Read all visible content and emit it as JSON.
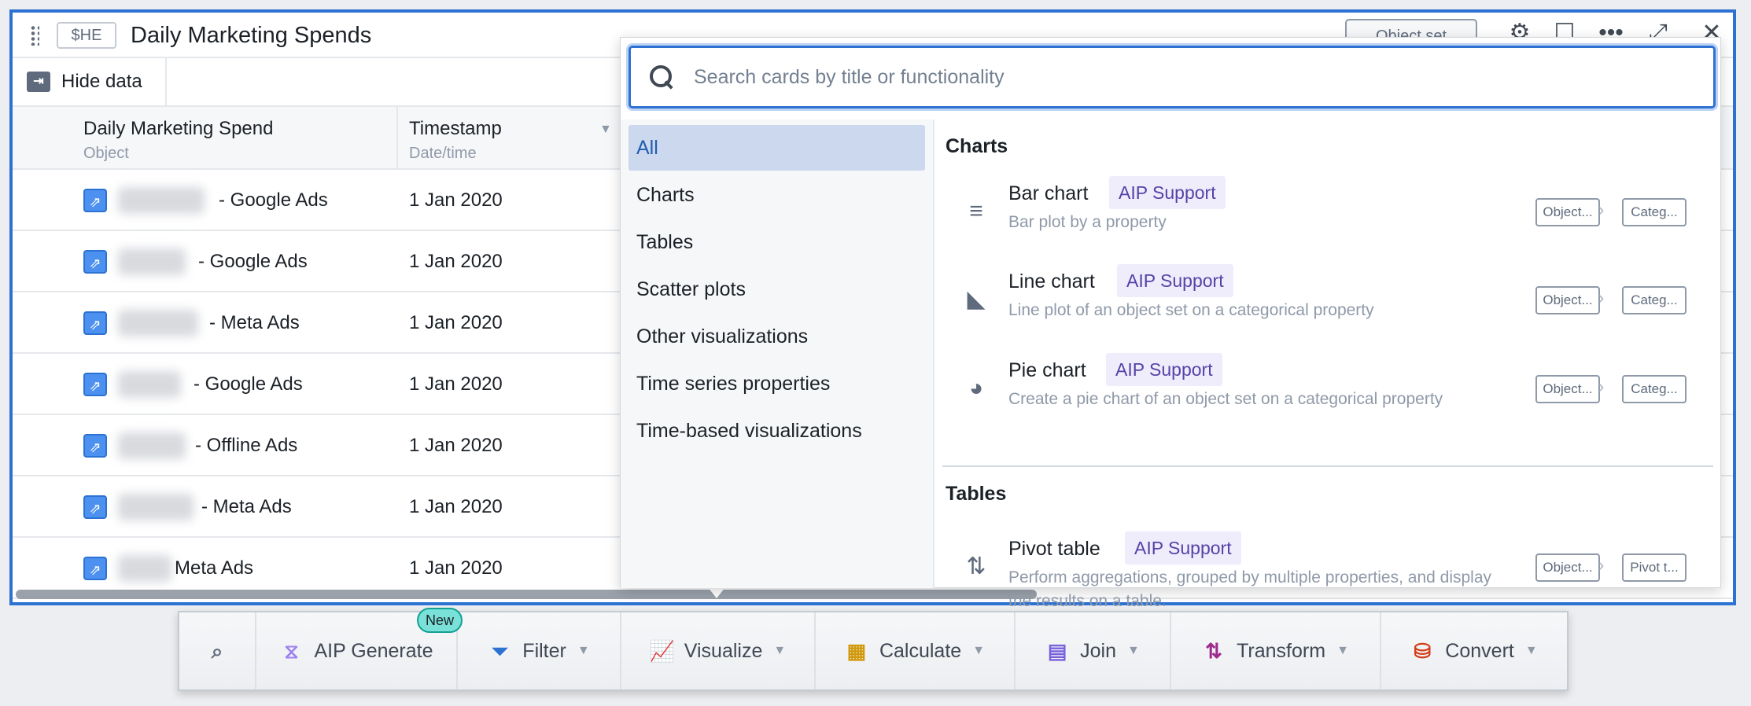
{
  "card": {
    "tag": "$HE",
    "title": "Daily Marketing Spends",
    "object_set_label": "Object set",
    "hide_data_label": "Hide data"
  },
  "table": {
    "columns": [
      {
        "name": "Daily Marketing Spend",
        "type": "Object"
      },
      {
        "name": "Timestamp",
        "type": "Date/time"
      }
    ],
    "rows": [
      {
        "name": "- Google Ads",
        "date": "1 Jan 2020"
      },
      {
        "name": "- Google Ads",
        "date": "1 Jan 2020"
      },
      {
        "name": "- Meta Ads",
        "date": "1 Jan 2020"
      },
      {
        "name": "- Google Ads",
        "date": "1 Jan 2020"
      },
      {
        "name": "- Offline Ads",
        "date": "1 Jan 2020"
      },
      {
        "name": "- Meta Ads",
        "date": "1 Jan 2020"
      },
      {
        "name": "Meta Ads",
        "date": "1 Jan 2020"
      }
    ]
  },
  "popover": {
    "search_placeholder": "Search cards by title or functionality",
    "nav": [
      "All",
      "Charts",
      "Tables",
      "Scatter plots",
      "Other visualizations",
      "Time series properties",
      "Time-based visualizations"
    ],
    "selected_nav": "All",
    "sections": [
      {
        "title": "Charts",
        "items": [
          {
            "name": "Bar chart",
            "badge": "AIP Support",
            "desc": "Bar plot by a property",
            "chips": [
              "Object...",
              "Categ..."
            ],
            "icon": "bar-chart-icon"
          },
          {
            "name": "Line chart",
            "badge": "AIP Support",
            "desc": "Line plot of an object set on a categorical property",
            "chips": [
              "Object...",
              "Categ..."
            ],
            "icon": "line-chart-icon"
          },
          {
            "name": "Pie chart",
            "badge": "AIP Support",
            "desc": "Create a pie chart of an object set on a categorical property",
            "chips": [
              "Object...",
              "Categ..."
            ],
            "icon": "pie-chart-icon"
          }
        ]
      },
      {
        "title": "Tables",
        "items": [
          {
            "name": "Pivot table",
            "badge": "AIP Support",
            "desc": "Perform aggregations, grouped by multiple properties, and display the results on a table.",
            "chips": [
              "Object...",
              "Pivot t..."
            ],
            "icon": "pivot-table-icon"
          }
        ]
      }
    ]
  },
  "toolbar": {
    "new_badge": "New",
    "items": [
      {
        "label": "AIP Generate",
        "color": "#9d7ff0"
      },
      {
        "label": "Filter",
        "color": "#2d72d2"
      },
      {
        "label": "Visualize",
        "color": "#238c2c"
      },
      {
        "label": "Calculate",
        "color": "#d1980b"
      },
      {
        "label": "Join",
        "color": "#7961db"
      },
      {
        "label": "Transform",
        "color": "#9e2b8e"
      },
      {
        "label": "Convert",
        "color": "#d33d17"
      }
    ]
  }
}
